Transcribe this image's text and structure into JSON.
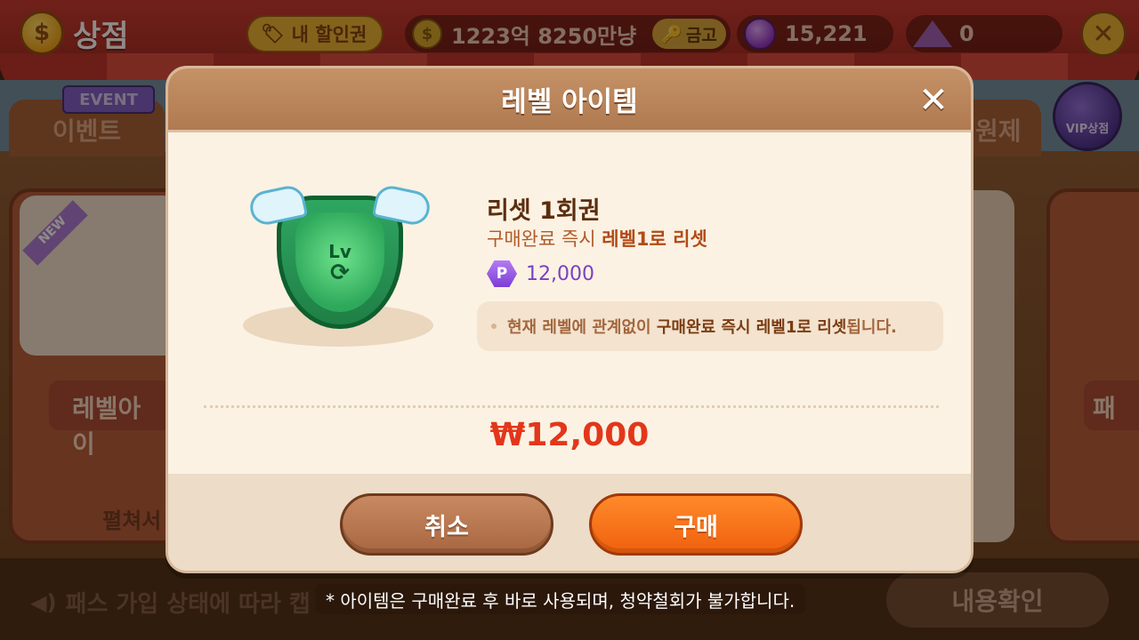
{
  "shop": {
    "title": "상점",
    "coupon_label": "내 할인권",
    "gold": "1223억 8250만냥",
    "vault_label": "금고",
    "gems": "15,221",
    "triangle_count": "0",
    "event_flag": "EVENT",
    "event_tab": "이벤트",
    "right_tab": "원제",
    "vip_label": "VIP상점",
    "left_card_new": "NEW",
    "left_card_label": "레벨아이",
    "left_card_foot": "펼쳐서",
    "right_card_label": "패",
    "bottom_note": "패스 가입 상태에 따라 캡",
    "confirm_button": "내용확인"
  },
  "modal": {
    "title": "레벨 아이템",
    "item_name": "리셋 1회권",
    "desc_prefix": "구매완료 즉시 ",
    "desc_highlight": "레벨1로 리셋",
    "p_icon_letter": "P",
    "p_price": "12,000",
    "info_prefix": "현재 레벨에 관계없이 ",
    "info_strong": "구매완료 즉시 레벨1로 리셋",
    "info_suffix": "됩니다.",
    "total_price": "₩12,000",
    "cancel_button": "취소",
    "buy_button": "구매",
    "badge_lv": "Lv",
    "badge_cycle": "⟳"
  },
  "footnote": "* 아이템은 구매완료 후 바로 사용되며, 청약철회가 불가합니다.",
  "colors": {
    "accent_buy": "#f0600e",
    "price_red": "#e3361b",
    "header_brown": "#b07a50"
  },
  "icons": [
    "coin-icon",
    "vault-key-icon",
    "gem-icon",
    "triangle-gem-icon",
    "close-icon",
    "speaker-icon",
    "p-currency-icon",
    "level-badge-icon"
  ]
}
